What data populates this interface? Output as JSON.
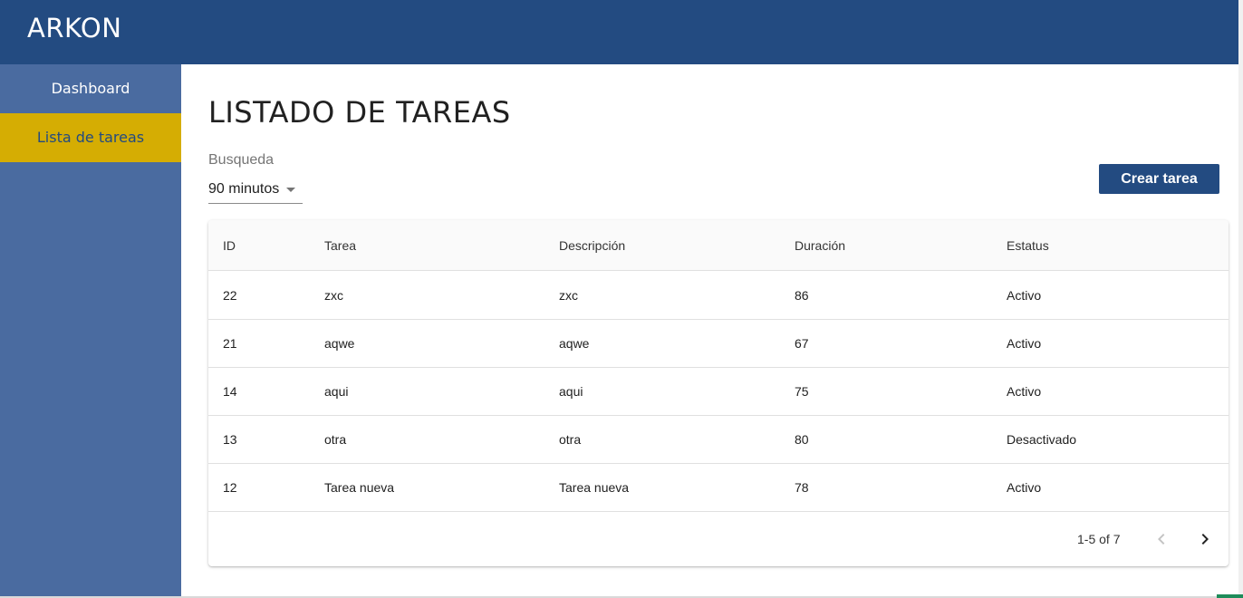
{
  "header": {
    "brand": "ARKON"
  },
  "sidebar": {
    "items": [
      {
        "label": "Dashboard",
        "active": false
      },
      {
        "label": "Lista de tareas",
        "active": true
      }
    ]
  },
  "main": {
    "title": "LISTADO DE TAREAS",
    "search": {
      "label": "Busqueda",
      "selected": "90 minutos"
    },
    "create_button": "Crear tarea"
  },
  "table": {
    "columns": [
      "ID",
      "Tarea",
      "Descripción",
      "Duración",
      "Estatus"
    ],
    "rows": [
      [
        "22",
        "zxc",
        "zxc",
        "86",
        "Activo"
      ],
      [
        "21",
        "aqwe",
        "aqwe",
        "67",
        "Activo"
      ],
      [
        "14",
        "aqui",
        "aqui",
        "75",
        "Activo"
      ],
      [
        "13",
        "otra",
        "otra",
        "80",
        "Desactivado"
      ],
      [
        "12",
        "Tarea nueva",
        "Tarea nueva",
        "78",
        "Activo"
      ]
    ]
  },
  "pagination": {
    "range": "1-5 of 7"
  },
  "colors": {
    "header": "#234b81",
    "sidebar": "#4a6ba0",
    "active_nav": "#d5ad03",
    "button": "#234b81"
  },
  "icons": {
    "dropdown": "caret-down-icon",
    "prev": "chevron-left-icon",
    "next": "chevron-right-icon"
  }
}
